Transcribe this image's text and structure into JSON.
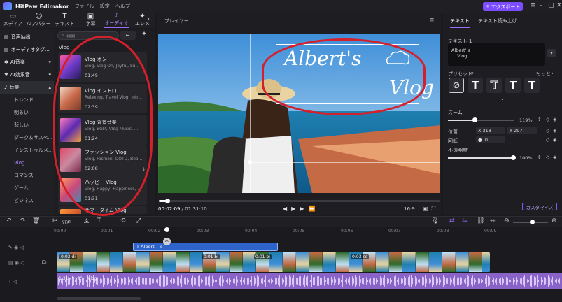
{
  "app": {
    "name": "HitPaw Edimakor",
    "menus": [
      "ファイル",
      "設定",
      "ヘルプ"
    ],
    "export_label": "エクスポート"
  },
  "tabs": [
    {
      "label": "メディア",
      "icon": "folder-icon"
    },
    {
      "label": "AIアバター",
      "icon": "avatar-icon"
    },
    {
      "label": "テキスト",
      "icon": "text-icon"
    },
    {
      "label": "字幕",
      "icon": "subtitle-icon"
    },
    {
      "label": "オーディオ",
      "icon": "music-note-icon",
      "active": true
    },
    {
      "label": "エレメ",
      "icon": "element-icon"
    }
  ],
  "sidebar": {
    "items": [
      {
        "label": "音声抽出"
      },
      {
        "label": "オーディオタグ..."
      },
      {
        "label": "AI音楽"
      },
      {
        "label": "AI効果音"
      },
      {
        "label": "音楽"
      }
    ],
    "subitems": [
      "トレンド",
      "明るい",
      "悲しい",
      "ダーク＆サスペ...",
      "インストゥルメ...",
      "Vlog",
      "ロマンス",
      "ゲーム",
      "ビジネス"
    ]
  },
  "assets": {
    "search_placeholder": "検索",
    "section": "Vlog",
    "cards": [
      {
        "title": "Vlog オン",
        "tags": "Vlog, Vlog On, Joyful, Su...",
        "duration": "01:49"
      },
      {
        "title": "Vlog イントロ",
        "tags": "Relaxing, Travel Vlog, Intr...",
        "duration": "02:39"
      },
      {
        "title": "Vlog 背景音楽",
        "tags": "Vlog, BGM, Vlog Music, ...",
        "duration": "01:24"
      },
      {
        "title": "ファッション Vlog",
        "tags": "Vlog, Fashion, OOTD, Bea...",
        "duration": "02:08"
      },
      {
        "title": "ハッピー Vlog",
        "tags": "Vlog, Happy, Happiness, ...",
        "duration": "01:31"
      },
      {
        "title": "サマータイム Vlog",
        "tags": "",
        "duration": ""
      }
    ]
  },
  "player": {
    "label": "プレイヤー",
    "overlay_text_line1": "Albert's",
    "overlay_text_line2": "Vlog",
    "current_time": "00:02:09",
    "total_time": "/ 01:31:10",
    "aspect": "16:9",
    "progress_fraction": 0.03
  },
  "props": {
    "tabs": [
      "テキスト",
      "テキスト読み上げ"
    ],
    "text_label": "テキスト 1",
    "text_value_line1": "Albert' s",
    "text_value_line2": "Vlog",
    "preset_label": "プリセット",
    "more_label": "もっと",
    "zoom_label": "ズーム",
    "zoom_value": "119%",
    "position_label": "位置",
    "pos_x_label": "X",
    "pos_x": "318",
    "pos_y_label": "Y",
    "pos_y": "297",
    "rotation_label": "回転",
    "rotation": "0",
    "opacity_label": "不透明度",
    "opacity_value": "100%",
    "customize_label": "カスタマイズ"
  },
  "toolbar": {
    "split_label": "分割"
  },
  "timeline": {
    "ruler": [
      "00:00",
      "00:01",
      "00:02",
      "00:03",
      "00:04",
      "00:05",
      "00:06",
      "00:07",
      "00:08",
      "00:09"
    ],
    "text_clip": "Albert'　s",
    "video_clips": [
      "0:03 di",
      "0:01 bi",
      "0:01 bi",
      "0:03 cc"
    ],
    "audio_clip": "1:31 ハッピー Vlog"
  },
  "colors": {
    "accent": "#9a6bff",
    "highlight_red": "#d4202a",
    "export_bg": "#7b4dff",
    "text_clip": "#2e63c9",
    "audio_clip": "#8a63c9"
  }
}
